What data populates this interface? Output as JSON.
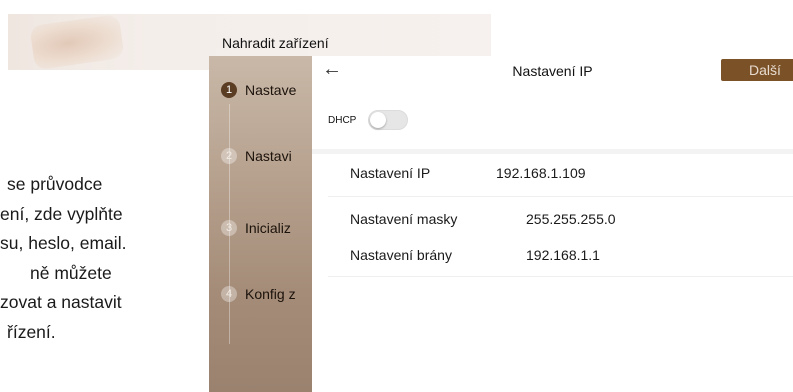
{
  "dialog": {
    "title": "Nahradit zařízení"
  },
  "description": {
    "lines": [
      "se průvodce",
      "ení, zde vyplňte",
      "su, heslo, email.",
      "ně můžete",
      "zovat a nastavit",
      "řízení."
    ]
  },
  "wizard": {
    "steps": [
      {
        "number": "1",
        "label": "Nastave",
        "sub": "",
        "active": true
      },
      {
        "number": "2",
        "label": "Nastavi",
        "sub": "",
        "active": false
      },
      {
        "number": "3",
        "label": "Inicializ",
        "sub": "",
        "active": false
      },
      {
        "number": "4",
        "label": "Konfig z",
        "sub": "",
        "active": false
      }
    ]
  },
  "panel": {
    "title": "Nastavení IP",
    "next_label": "Další",
    "dhcp": {
      "label": "DHCP",
      "enabled": false
    },
    "fields": [
      {
        "label": "Nastavení IP",
        "value": "192.168.1.109"
      },
      {
        "label": "Nastavení masky",
        "value": "255.255.255.0"
      },
      {
        "label": "Nastavení brány",
        "value": "192.168.1.1"
      }
    ]
  },
  "colors": {
    "accent": "#7b5128",
    "step_active": "#5b3d23",
    "step_panel": "#b7a28f"
  },
  "icons": {
    "back": "arrow-left-icon"
  }
}
